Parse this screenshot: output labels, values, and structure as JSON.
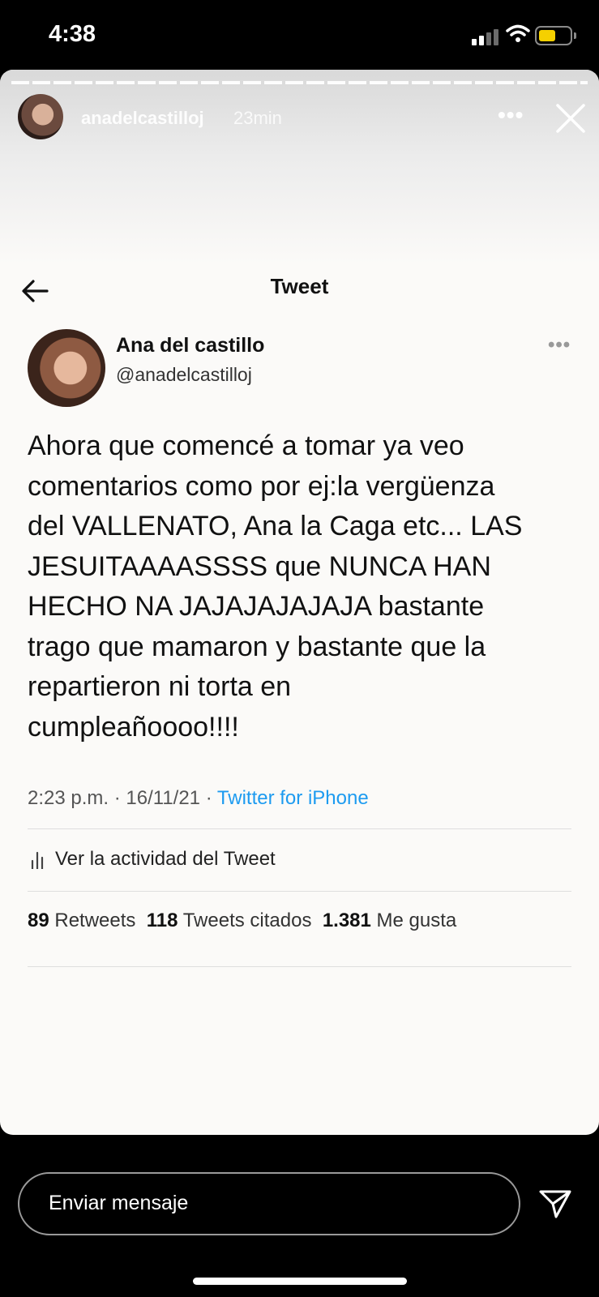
{
  "status_bar": {
    "time": "4:38",
    "battery_color": "#f5d000"
  },
  "story": {
    "username": "anadelcastilloj",
    "time_ago": "23min",
    "more_icon": "more-horizontal-icon",
    "close_icon": "close-icon"
  },
  "tweet": {
    "header_title": "Tweet",
    "author_name": "Ana del castillo",
    "author_handle": "@anadelcastilloj",
    "lines": [
      "Ahora que comencé a tomar ya veo",
      "comentarios como por ej:la vergüenza",
      "del VALLENATO, Ana la Caga etc... LAS",
      "JESUITAAAASSSS que NUNCA HAN",
      "HECHO NA JAJAJAJAJAJA bastante",
      "trago que mamaron y bastante que la",
      "repartieron ni torta en",
      "cumpleañoooo!!!!"
    ],
    "timestamp": "2:23 p.m. · 16/11/21 · ",
    "source": "Twitter for iPhone",
    "source_color": "#1d9bf0",
    "activity_label": "Ver la actividad del Tweet",
    "stats": {
      "retweets_count": "89",
      "retweets_label": "Retweets",
      "quotes_count": "118",
      "quotes_label": "Tweets citados",
      "likes_count": "1.381",
      "likes_label": "Me gusta"
    }
  },
  "message_bar": {
    "placeholder": "Enviar mensaje",
    "send_icon": "send-icon"
  }
}
